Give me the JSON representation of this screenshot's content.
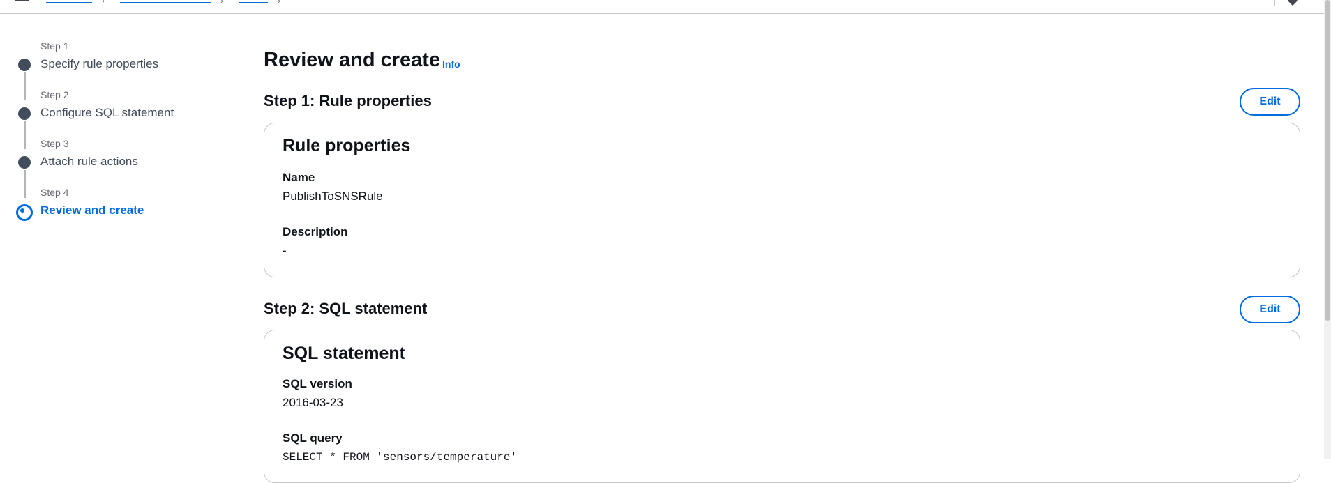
{
  "steps": [
    {
      "num": "Step 1",
      "title": "Specify rule properties",
      "active": false
    },
    {
      "num": "Step 2",
      "title": "Configure SQL statement",
      "active": false
    },
    {
      "num": "Step 3",
      "title": "Attach rule actions",
      "active": false
    },
    {
      "num": "Step 4",
      "title": "Review and create",
      "active": true
    }
  ],
  "page": {
    "title": "Review and create",
    "info_label": "Info"
  },
  "section1": {
    "heading": "Step 1: Rule properties",
    "edit_label": "Edit",
    "card_title": "Rule properties",
    "name_label": "Name",
    "name_value": "PublishToSNSRule",
    "description_label": "Description",
    "description_value": "-"
  },
  "section2": {
    "heading": "Step 2: SQL statement",
    "edit_label": "Edit",
    "card_title": "SQL statement",
    "version_label": "SQL version",
    "version_value": "2016-03-23",
    "query_label": "SQL query",
    "query_value": "SELECT * FROM 'sensors/temperature'"
  },
  "colors": {
    "accent": "#006ce0",
    "text": "#0f141a",
    "muted": "#656871",
    "border": "#c6c6cd"
  }
}
